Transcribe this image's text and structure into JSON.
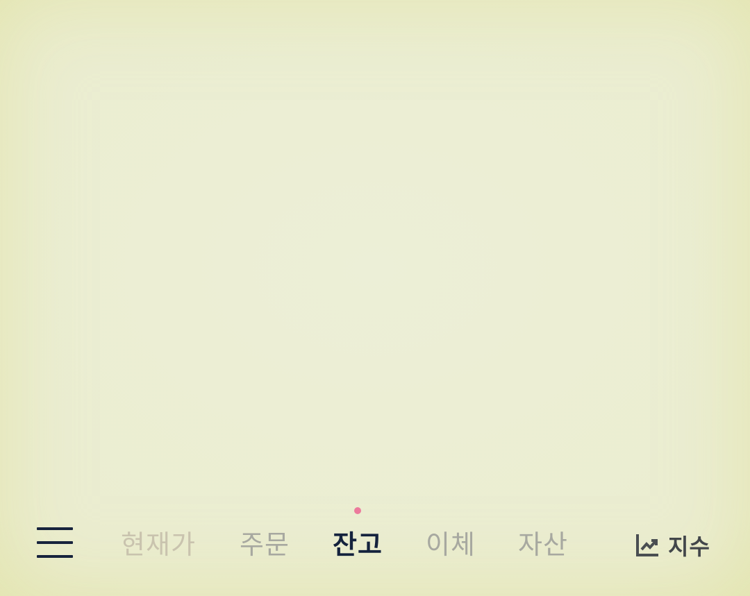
{
  "colors": {
    "background": "#ebedd0",
    "active_tab": "#14223d",
    "inactive_tab": "#a7a8a0",
    "indicator_dot": "#ec7a9c",
    "menu_icon": "#17233d"
  },
  "bottom_nav": {
    "menu_icon": "hamburger-menu-icon",
    "tabs": [
      {
        "label": "현재가",
        "active": false
      },
      {
        "label": "주문",
        "active": false
      },
      {
        "label": "잔고",
        "active": true
      },
      {
        "label": "이체",
        "active": false
      },
      {
        "label": "자산",
        "active": false
      }
    ],
    "index_button": {
      "icon": "trending-up-chart-icon",
      "label": "지수"
    }
  }
}
